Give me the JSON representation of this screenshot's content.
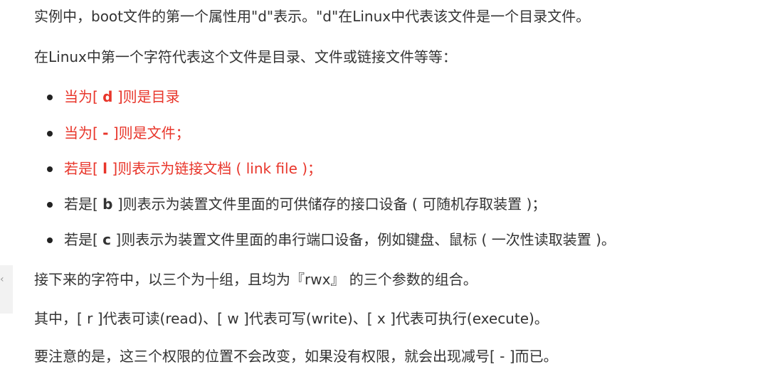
{
  "paragraphs": {
    "p1": "实例中，boot文件的第一个属性用\"d\"表示。\"d\"在Linux中代表该文件是一个目录文件。",
    "p2": "在Linux中第一个字符代表这个文件是目录、文件或链接文件等等：",
    "p3": "接下来的字符中，以三个为一组，且均为『rwx』 的三个参数的组合。",
    "p4": "其中，[ r ]代表可读(read)、[ w ]代表可写(write)、[ x ]代表可执行(execute)。",
    "p5": "要注意的是，这三个权限的位置不会改变，如果没有权限，就会出现减号[ - ]而已。"
  },
  "list": [
    {
      "prefix": "当为[ ",
      "code": "d",
      "suffix": " ]则是目录",
      "color": "#e8352a"
    },
    {
      "prefix": "当为[ ",
      "code": "-",
      "suffix": " ]则是文件；",
      "color": "#e8352a"
    },
    {
      "prefix": "若是[ ",
      "code": "l",
      "suffix": " ]则表示为链接文档 ( link file )；",
      "color": "#e8352a"
    },
    {
      "prefix": "若是[ ",
      "code": "b",
      "suffix": " ]则表示为装置文件里面的可供储存的接口设备 ( 可随机存取装置 )；",
      "color": "#333333"
    },
    {
      "prefix": "若是[ ",
      "code": "c",
      "suffix": " ]则表示为装置文件里面的串行端口设备，例如键盘、鼠标 ( 一次性读取装置 )。",
      "color": "#333333"
    }
  ],
  "side_panel": {
    "arrow": "‹"
  }
}
